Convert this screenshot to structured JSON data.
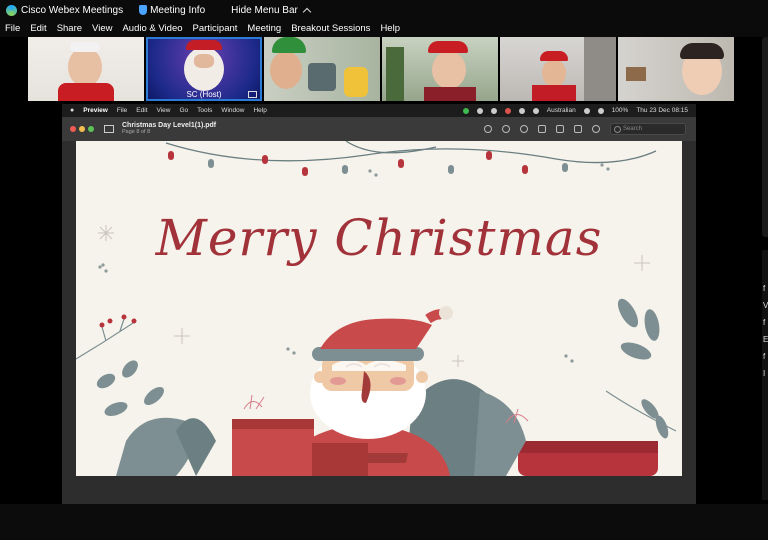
{
  "titlebar": {
    "app_title": "Cisco Webex Meetings",
    "meeting_info": "Meeting Info",
    "hide_menu_bar": "Hide Menu Bar"
  },
  "menu": [
    "File",
    "Edit",
    "Share",
    "View",
    "Audio & Video",
    "Participant",
    "Meeting",
    "Breakout Sessions",
    "Help"
  ],
  "participants": [
    {
      "name": ""
    },
    {
      "name": "SC  (Host)"
    },
    {
      "name": ""
    },
    {
      "name": ""
    },
    {
      "name": ""
    },
    {
      "name": ""
    }
  ],
  "mac": {
    "menus": [
      "Preview",
      "File",
      "Edit",
      "View",
      "Go",
      "Tools",
      "Window",
      "Help"
    ],
    "status": {
      "input": "Australian",
      "battery": "100%",
      "datetime": "Thu 23 Dec  08:15"
    }
  },
  "preview": {
    "doc_title": "Christmas Day Level1(1).pdf",
    "page_info": "Page 8 of 8",
    "search_placeholder": "Search"
  },
  "slide": {
    "title": "Merry Christmas"
  },
  "right_glyphs": [
    "f",
    "V",
    "f",
    "E",
    "f",
    "I"
  ],
  "colors": {
    "accent_blue": "#2c7cd6",
    "slide_bg": "#f6f3ec",
    "title_red": "#a2323a",
    "leaf_gray": "#7d8f92"
  }
}
